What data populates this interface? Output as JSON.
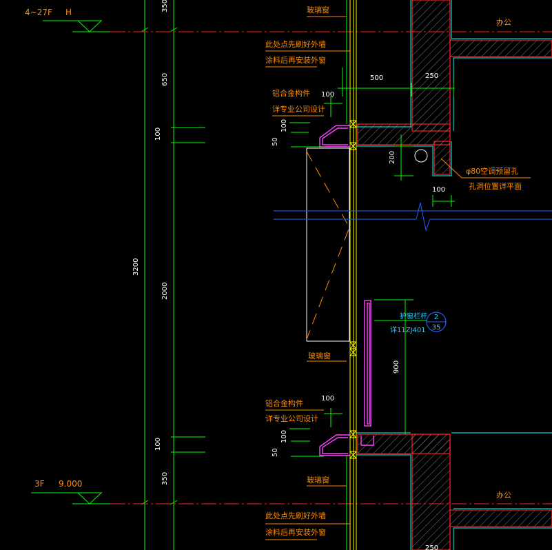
{
  "levels": [
    {
      "floor": "4~27F",
      "elev": "H"
    },
    {
      "floor": "3F",
      "elev": "9.000"
    }
  ],
  "rooms": [
    "办公",
    "办公"
  ],
  "notes": {
    "glass_window": "玻璃窗",
    "glass_window_2": "玻璃窗",
    "glass_window_3": "玻璃窗",
    "glass_window_4": "玻璃窗",
    "paint_line1": "此处点先刷好外墙",
    "paint_line2": "涂料后再安装外窗",
    "paint_line1b": "此处点先刷好外墙",
    "paint_line2b": "涂料后再安装外窗",
    "alum_line1": "铝合金构件",
    "alum_line2": "详专业公司设计",
    "alum_line1b": "铝合金构件",
    "alum_line2b": "详专业公司设计",
    "ac_hole_line1": "φ80空调预留孔",
    "ac_hole_line2": "孔洞位置详平面",
    "railing_line1": "护窗栏杆",
    "railing_line2": "详11ZJ401",
    "detail_num": "2",
    "detail_sheet": "35"
  },
  "dims": {
    "d350_top": "350",
    "d650": "650",
    "d100_left_a": "100",
    "d3200": "3200",
    "d2000": "2000",
    "d100_left_b": "100",
    "d350_bot": "350",
    "d500": "500",
    "d250_top": "250",
    "d250_bot": "250",
    "d100_a": "100",
    "d100_b": "100",
    "d50_a": "50",
    "d200": "200",
    "d100_c": "100",
    "d900": "900",
    "d100_d": "100",
    "d100_e": "100",
    "d50_b": "50"
  },
  "colors": {
    "background": "#000000",
    "green": "#00ff00",
    "red": "#ff2020",
    "cyan": "#00ffff",
    "orange": "#ff8c00",
    "yellow": "#ffff00",
    "magenta": "#ff44ff",
    "blue": "#2060ff",
    "white": "#ffffff",
    "hatch": "#bbbbbb"
  }
}
